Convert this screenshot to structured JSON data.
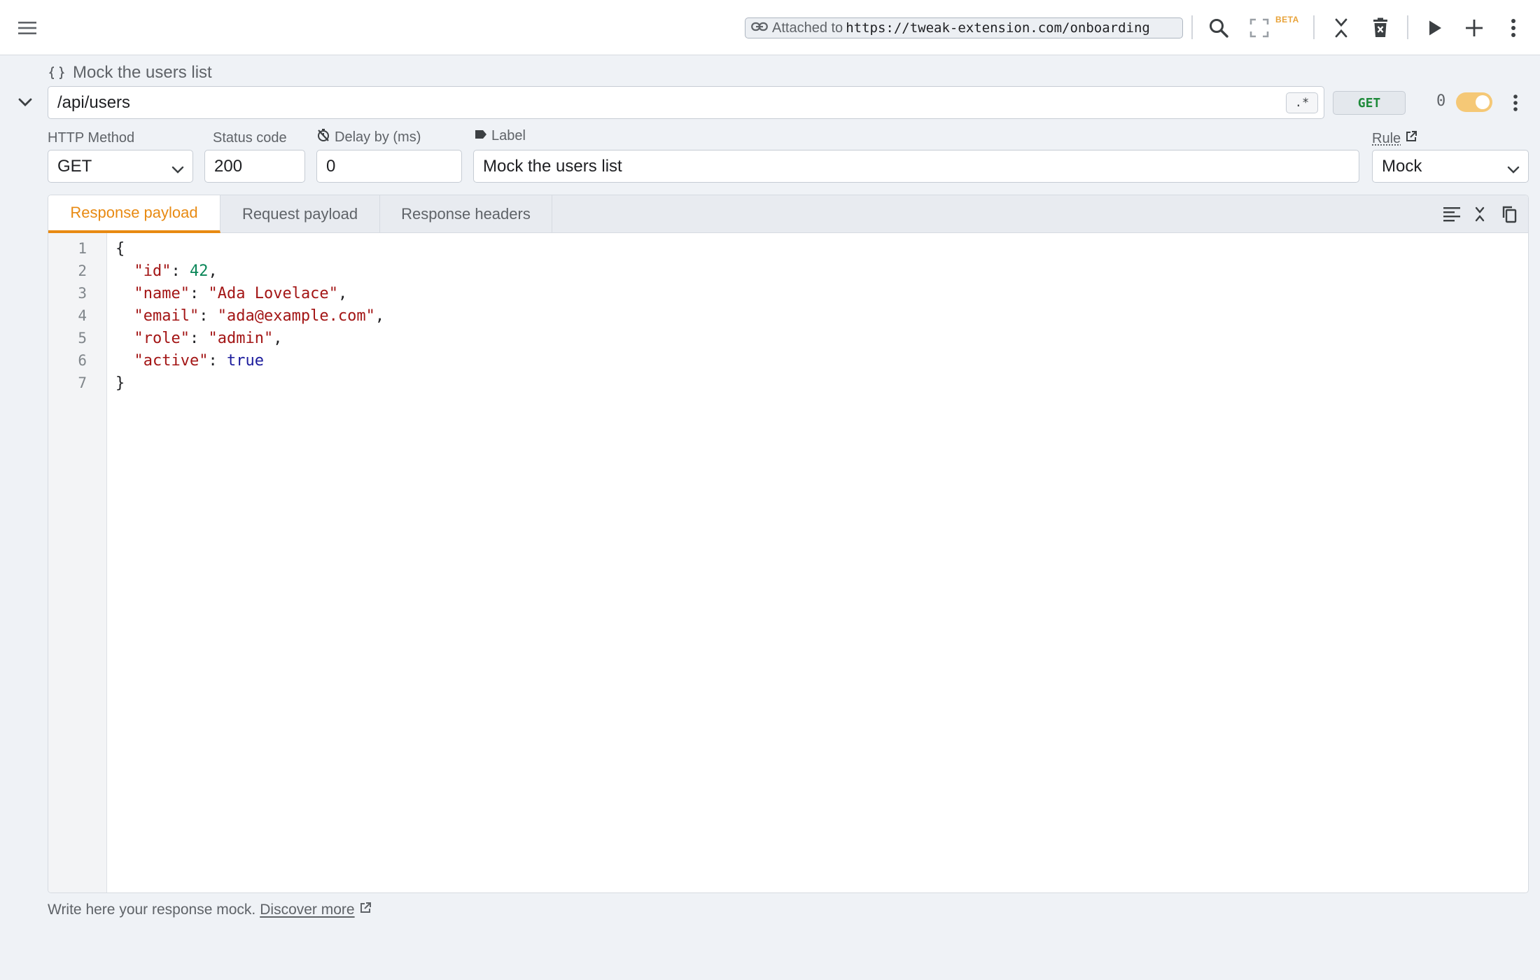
{
  "topbar": {
    "attached_label": "Attached to",
    "attached_url": "https://tweak-extension.com/onboarding",
    "beta_label": "BETA",
    "icons": [
      "menu-icon",
      "link-icon",
      "search-icon",
      "fullscreen-icon",
      "collapse-all-icon",
      "delete-icon",
      "play-icon",
      "add-icon",
      "more-vertical-icon"
    ]
  },
  "rule": {
    "title": "Mock the users list",
    "url_pattern": "/api/users",
    "regex_label": ".*",
    "method_badge": "GET",
    "hit_count": "0",
    "enabled": true
  },
  "fields": {
    "http_method_label": "HTTP Method",
    "http_method_value": "GET",
    "status_code_label": "Status code",
    "status_code_value": "200",
    "delay_label": "Delay by (ms)",
    "delay_value": "0",
    "label_label": "Label",
    "label_value": "Mock the users list",
    "rule_label": "Rule",
    "rule_value": "Mock"
  },
  "editor": {
    "tabs": [
      "Response payload",
      "Request payload",
      "Response headers"
    ],
    "active_tab": "Response payload",
    "line_numbers": [
      "1",
      "2",
      "3",
      "4",
      "5",
      "6",
      "7"
    ],
    "payload": {
      "id": 42,
      "name": "Ada Lovelace",
      "email": "ada@example.com",
      "role": "admin",
      "active": true
    }
  },
  "footer": {
    "hint": "Write here your response mock.",
    "link": "Discover more"
  },
  "colors": {
    "accent": "#e88a12",
    "method_green": "#1e8a3a",
    "toggle_on": "#f5c876",
    "background": "#eff2f6"
  }
}
